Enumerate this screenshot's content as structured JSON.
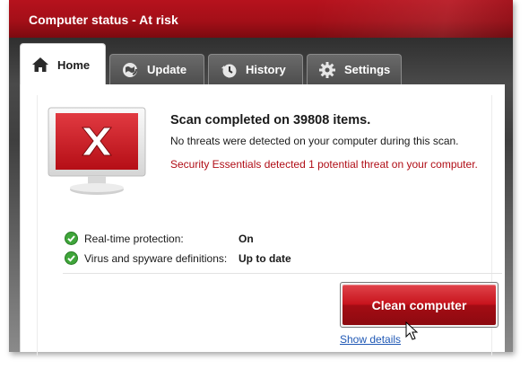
{
  "window": {
    "title": "Computer status - At risk",
    "accent_color": "#b6121d"
  },
  "tabs": [
    {
      "label": "Home",
      "icon": "home-icon",
      "active": true
    },
    {
      "label": "Update",
      "icon": "globe-refresh-icon",
      "active": false
    },
    {
      "label": "History",
      "icon": "clock-history-icon",
      "active": false
    },
    {
      "label": "Settings",
      "icon": "gear-icon",
      "active": false
    }
  ],
  "scan": {
    "heading": "Scan completed on 39808 items.",
    "detail": "No threats were detected on your computer during this scan.",
    "threat_message": "Security Essentials detected 1 potential threat on your computer.",
    "status_icon": "monitor-red-x-icon"
  },
  "status": [
    {
      "label": "Real-time protection:",
      "value": "On",
      "icon": "green-check-icon"
    },
    {
      "label": "Virus and spyware definitions:",
      "value": "Up to date",
      "icon": "green-check-icon"
    }
  ],
  "actions": {
    "clean_label": "Clean computer",
    "details_link": "Show details"
  }
}
